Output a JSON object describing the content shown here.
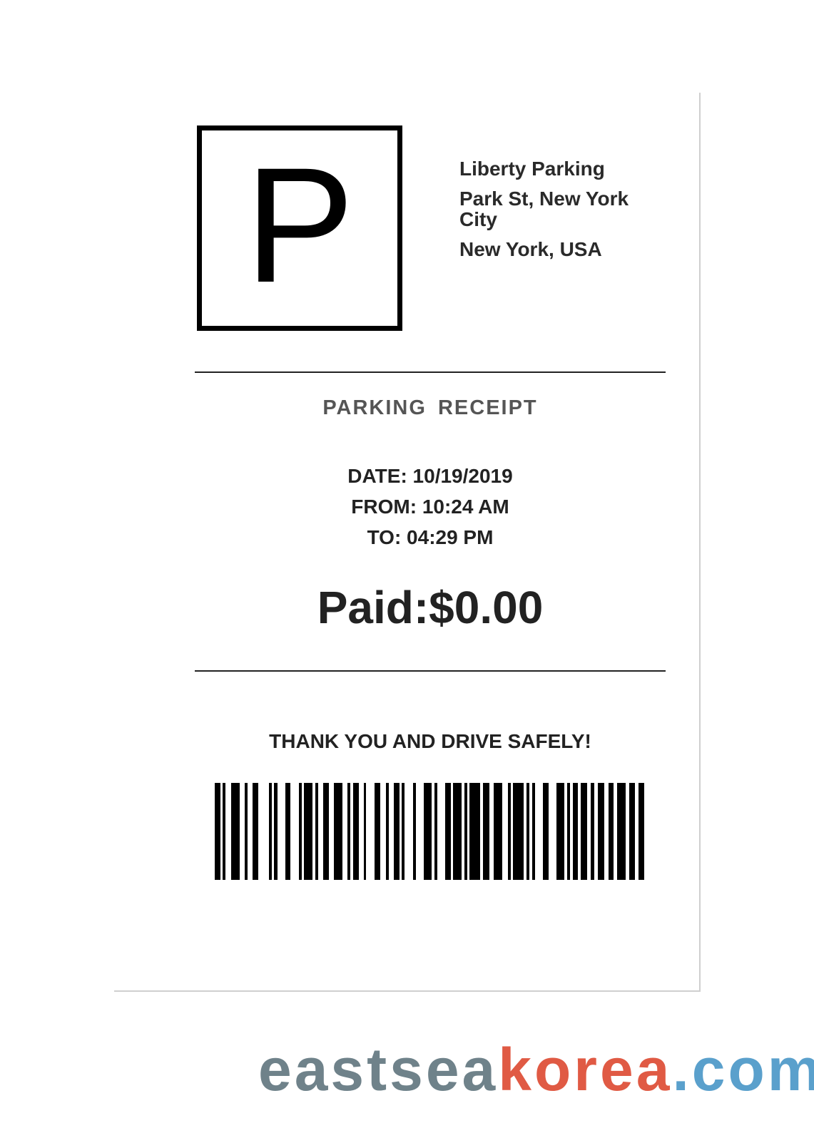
{
  "business": {
    "logo_letter": "P",
    "name": "Liberty Parking",
    "street": "Park St, New York City",
    "city": "New York, USA"
  },
  "receipt": {
    "title": "PARKING RECEIPT",
    "date": "DATE: 10/19/2019",
    "from": "FROM: 10:24 AM",
    "to": "TO: 04:29 PM",
    "paid": "Paid:$0.00",
    "thanks": "THANK YOU AND DRIVE SAFELY!"
  },
  "watermark": {
    "part1": "eastsea",
    "part2": "korea",
    "part3": ".com",
    "colors": [
      "#6f828a",
      "#e05a44",
      "#5aa0cc"
    ]
  }
}
